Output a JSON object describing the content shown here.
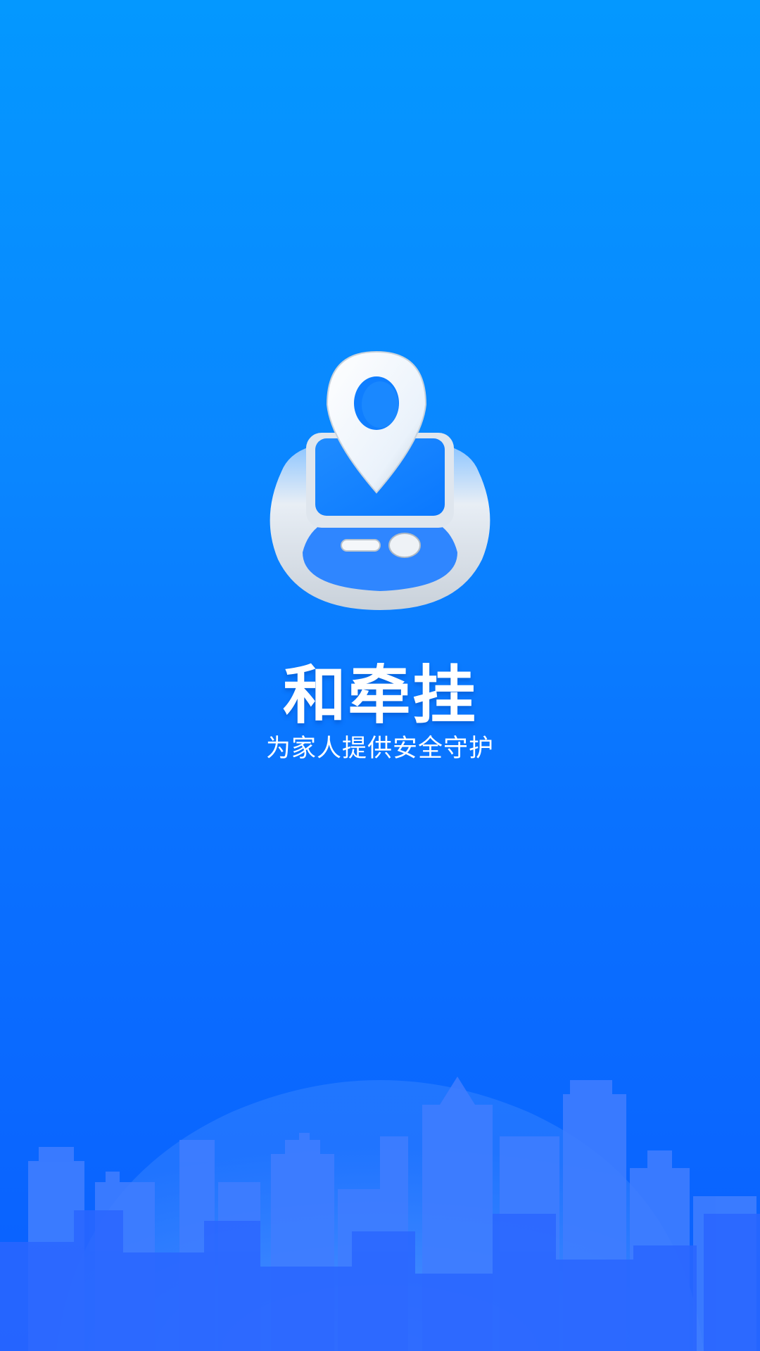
{
  "app": {
    "title": "和牵挂",
    "tagline": "为家人提供安全守护"
  },
  "icons": {
    "logo": "watch-location-pin-icon",
    "background": "city-skyline-illustration"
  },
  "colors": {
    "background_top": "#0498ff",
    "background_bottom": "#0a5fff",
    "text": "#ffffff"
  }
}
